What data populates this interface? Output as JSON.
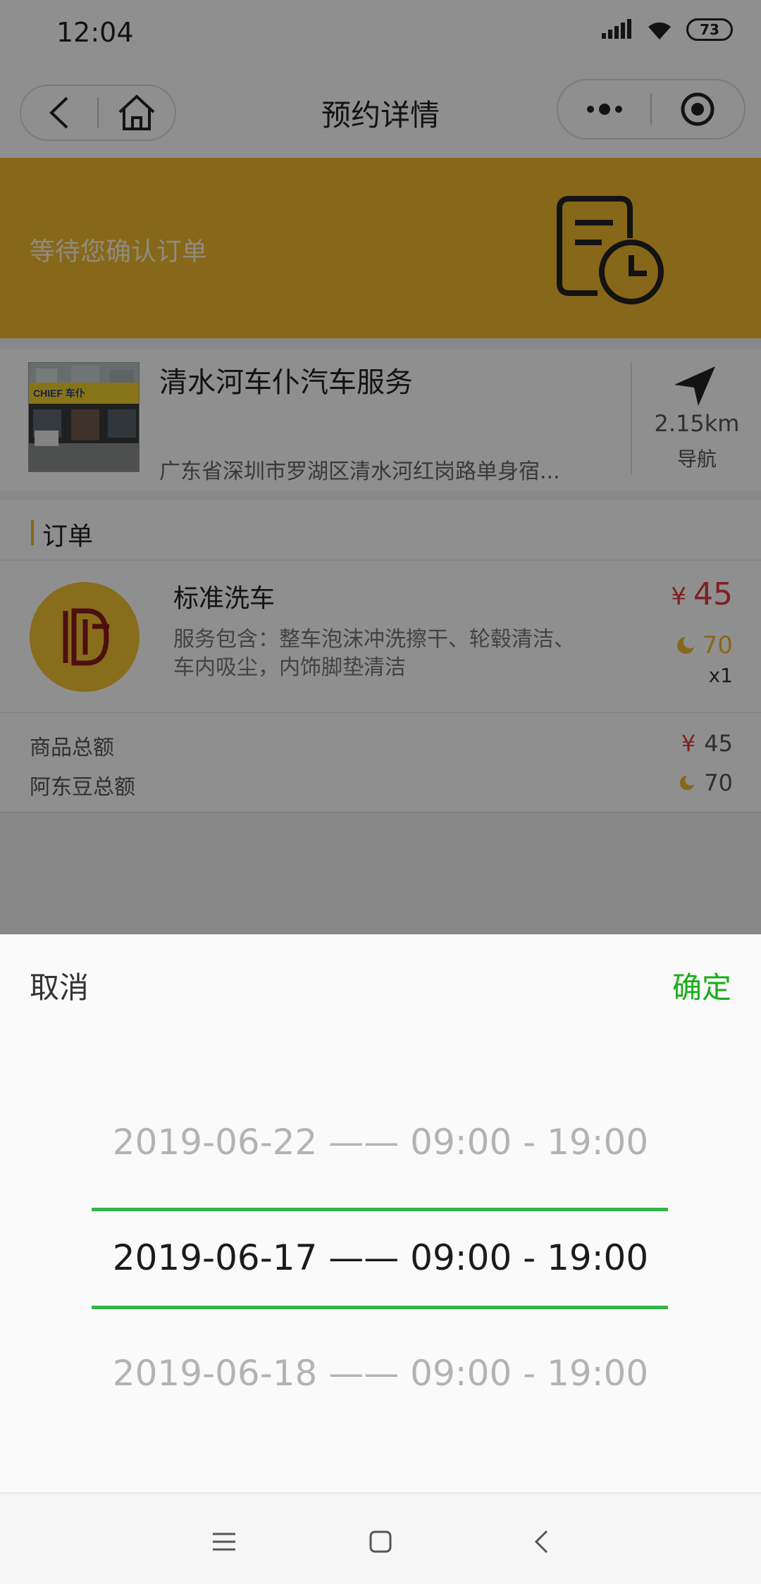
{
  "status_bar": {
    "time": "12:04",
    "battery": "73"
  },
  "nav": {
    "title": "预约详情"
  },
  "banner": {
    "status_text": "等待您确认订单"
  },
  "store": {
    "name": "清水河车仆汽车服务",
    "address": "广东省深圳市罗湖区清水河红岗路单身宿...",
    "distance": "2.15km",
    "nav_label": "导航",
    "sign_text": "CHIEF 车仆"
  },
  "order": {
    "section_title": "订单",
    "item": {
      "name": "标准洗车",
      "description": "服务包含：整车泡沫冲洗擦干、轮毂清洁、车内吸尘，内饰脚垫清洁",
      "currency": "¥",
      "price": "45",
      "beans": "70",
      "quantity": "x1"
    },
    "summary": {
      "goods_total_label": "商品总额",
      "goods_total_currency": "¥",
      "goods_total_value": "45",
      "beans_total_label": "阿东豆总额",
      "beans_total_value": "70"
    }
  },
  "picker": {
    "cancel_label": "取消",
    "confirm_label": "确定",
    "options": [
      "2019-06-22 —— 09:00 - 19:00",
      "2019-06-17 —— 09:00 - 19:00",
      "2019-06-18 —— 09:00 - 19:00"
    ],
    "selected_index": 1
  },
  "colors": {
    "banner": "#f0b82d",
    "accent_green": "#1aad19",
    "price_red": "#e4393c",
    "picker_line": "#33b34a"
  },
  "icons": [
    "signal-icon",
    "wifi-icon",
    "back-icon",
    "home-icon",
    "more-icon",
    "close-miniprogram-icon",
    "order-clock-icon",
    "navigation-arrow-icon",
    "bean-icon",
    "menu-icon",
    "home-square-icon",
    "system-back-icon"
  ]
}
